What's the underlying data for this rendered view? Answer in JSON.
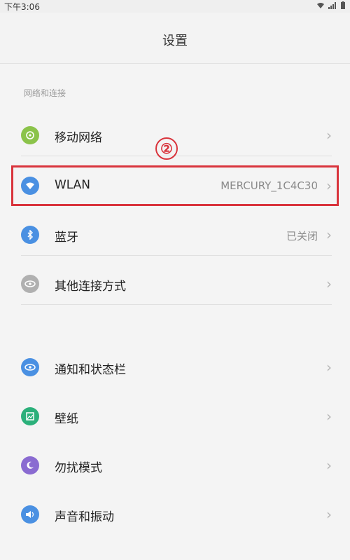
{
  "statusbar": {
    "time": "下午3:06",
    "wifi_icon": "wifi-icon",
    "signal_icon": "signal-icon",
    "battery_icon": "battery-icon"
  },
  "header": {
    "title": "设置"
  },
  "sections": {
    "network_title": "网络和连接"
  },
  "rows": [
    {
      "id": "mobile-network",
      "label": "移动网络",
      "value": "",
      "icon": "mobile-network-icon",
      "icon_color": "#8bc34a"
    },
    {
      "id": "wlan",
      "label": "WLAN",
      "value": "MERCURY_1C4C30",
      "icon": "wifi-icon",
      "icon_color": "#4a90e2"
    },
    {
      "id": "bluetooth",
      "label": "蓝牙",
      "value": "已关闭",
      "icon": "bluetooth-icon",
      "icon_color": "#4a90e2"
    },
    {
      "id": "other-connections",
      "label": "其他连接方式",
      "value": "",
      "icon": "link-icon",
      "icon_color": "#b0b0b0"
    },
    {
      "id": "notifications",
      "label": "通知和状态栏",
      "value": "",
      "icon": "eye-icon",
      "icon_color": "#4a90e2"
    },
    {
      "id": "wallpaper",
      "label": "壁纸",
      "value": "",
      "icon": "wallpaper-icon",
      "icon_color": "#2bb07a"
    },
    {
      "id": "do-not-disturb",
      "label": "勿扰模式",
      "value": "",
      "icon": "moon-icon",
      "icon_color": "#8a6bd1"
    },
    {
      "id": "sound",
      "label": "声音和振动",
      "value": "",
      "icon": "speaker-icon",
      "icon_color": "#4a90e2"
    }
  ],
  "annotation": {
    "marker": "②",
    "accent_color": "#d9343c"
  }
}
